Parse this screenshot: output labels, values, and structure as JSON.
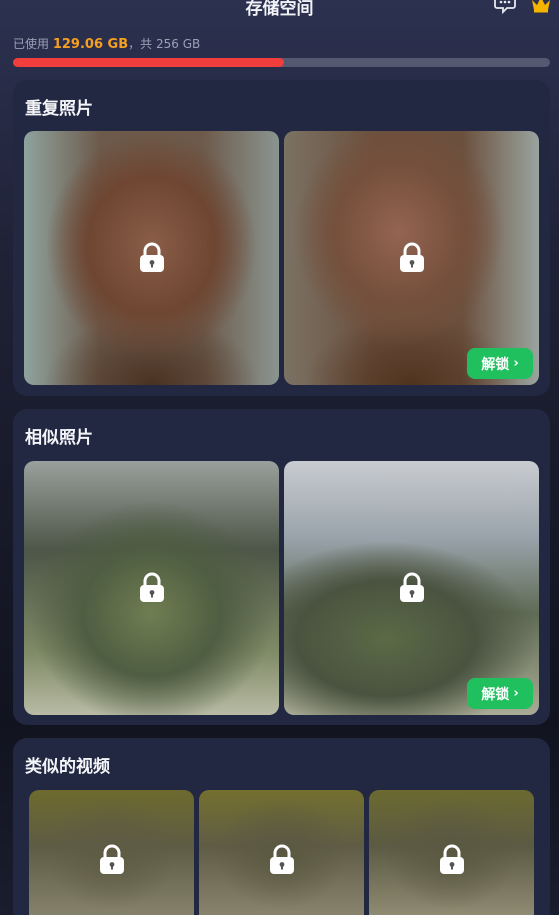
{
  "header": {
    "title": "存储空间",
    "chat_icon": "chat-bubble-icon",
    "crown_icon": "crown-icon",
    "crown_color": "#f5b400"
  },
  "storage": {
    "used_prefix": "已使用",
    "used_value": "129.06 GB",
    "separator": "，共",
    "total_value": "256 GB",
    "used_fraction": 0.504,
    "bar_color": "#f13d3b",
    "used_text_color": "#f5a020"
  },
  "sections": [
    {
      "title": "重复照片",
      "unlock_label": "解锁",
      "unlock_chevron": "›"
    },
    {
      "title": "相似照片",
      "unlock_label": "解锁",
      "unlock_chevron": "›"
    },
    {
      "title": "类似的视频"
    }
  ],
  "accent": {
    "unlock_button": "#21c05f"
  }
}
